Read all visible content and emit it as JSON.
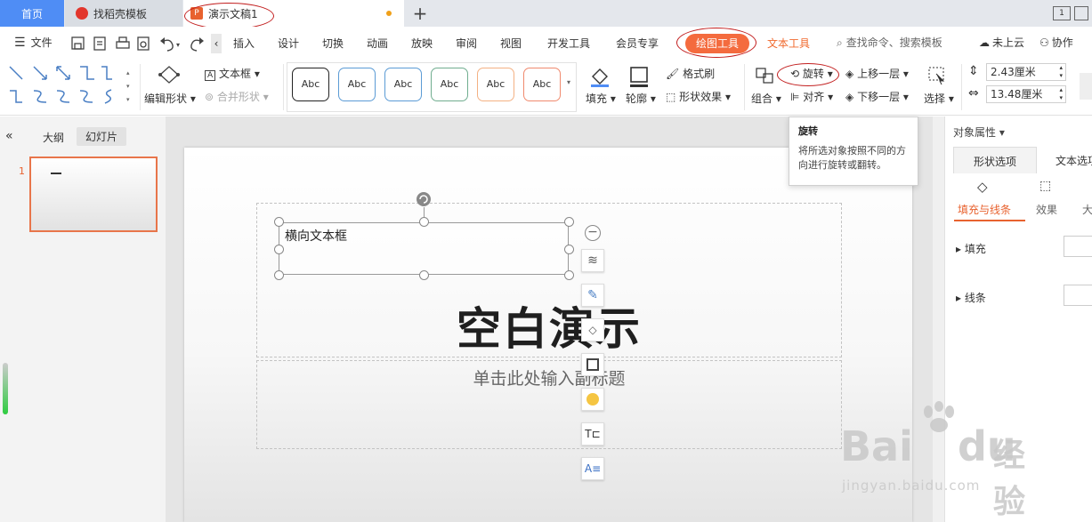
{
  "tabs": {
    "home": "首页",
    "template": "找稻壳模板",
    "doc": "演示文稿1",
    "add": "+"
  },
  "window": {
    "layout_btn": "1",
    "page_count": "1"
  },
  "menu": {
    "file": "文件",
    "items": [
      "插入",
      "设计",
      "切换",
      "动画",
      "放映",
      "审阅",
      "视图",
      "开发工具",
      "会员专享"
    ],
    "drawing_tools": "绘图工具",
    "text_tools": "文本工具",
    "search": "查找命令、搜索模板",
    "cloud": "未上云",
    "collab": "协作"
  },
  "ribbon": {
    "edit_shape": "编辑形状",
    "textbox": "文本框",
    "merge_shape": "合并形状",
    "style_label": "Abc",
    "style_colors": [
      "#222222",
      "#5b9bd5",
      "#5b9bd5",
      "#70ad8f",
      "#f4b183",
      "#f08a6e"
    ],
    "fill": "填充",
    "outline": "轮廓",
    "format_painter": "格式刷",
    "shape_effect": "形状效果",
    "group": "组合",
    "rotate": "旋转",
    "align": "对齐",
    "bring_forward": "上移一层",
    "send_backward": "下移一层",
    "select": "选择",
    "height": "2.43厘米",
    "width": "13.48厘米"
  },
  "left": {
    "outline": "大纲",
    "slides": "幻灯片",
    "slide_no": "1"
  },
  "slide": {
    "textbox": "横向文本框",
    "title": "空白演示",
    "subtitle": "单击此处输入副标题"
  },
  "tooltip": {
    "title": "旋转",
    "body": "将所选对象按照不同的方向进行旋转或翻转。"
  },
  "right": {
    "header": "对象属性",
    "tab_shape": "形状选项",
    "tab_text": "文本选项",
    "sub_fill": "填充与线条",
    "sub_effect": "效果",
    "sub_size": "大",
    "fill": "填充",
    "line": "线条"
  },
  "watermark": {
    "logo": "Bai",
    "logo2": "du",
    "brand": "经验",
    "url": "jingyan.baidu.com"
  }
}
